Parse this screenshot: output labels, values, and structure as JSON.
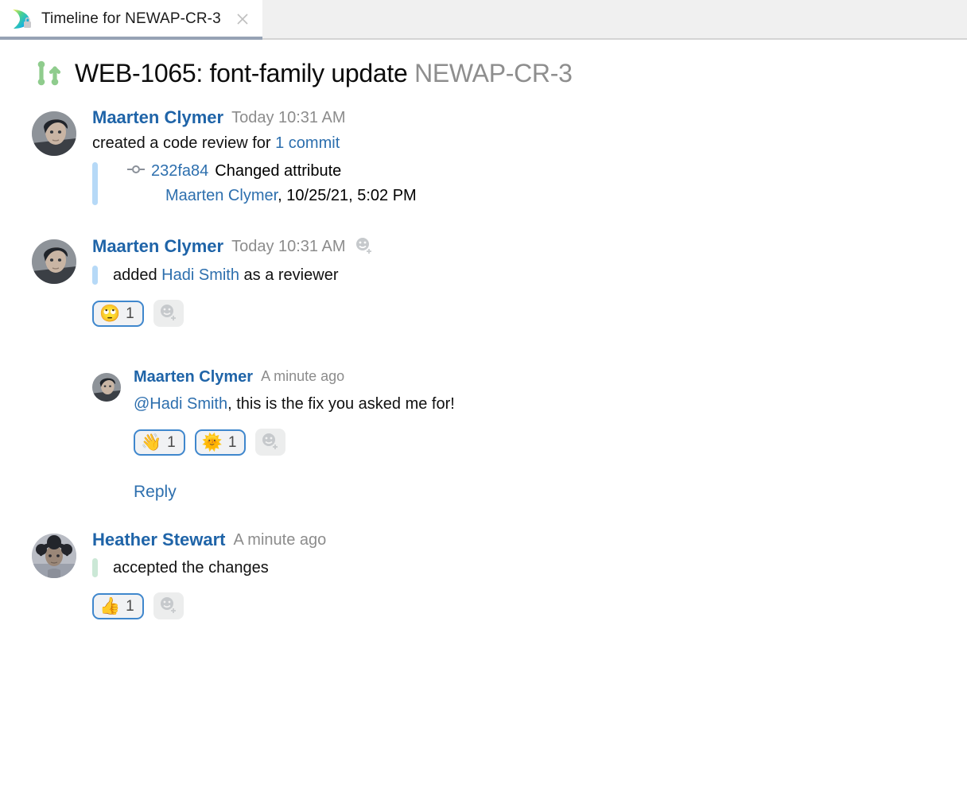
{
  "tab": {
    "title": "Timeline for NEWAP-CR-3",
    "icon": "upsource-logo-icon",
    "close_label": "×"
  },
  "header": {
    "icon": "branch-merge-icon",
    "issue_and_summary": "WEB-1065: font-family update",
    "review_key": "NEWAP-CR-3"
  },
  "colors": {
    "link": "#2d6fae",
    "author": "#1f64a8",
    "timestamp": "#8c8c8c",
    "rail_blue": "#b6d9f7",
    "rail_green": "#cbe8d6",
    "chip_border": "#3f87cd",
    "chip_background": "#f1f2f4",
    "tab_underline": "#96a2b4"
  },
  "timeline": [
    {
      "id": "entry-created-review",
      "author": "Maarten Clymer",
      "timestamp": "Today 10:31 AM",
      "text_prefix": "created a code review for ",
      "text_link": "1 commit",
      "commit": {
        "hash": "232fa84",
        "message": "Changed attribute",
        "author": "Maarten Clymer",
        "date": ", 10/25/21, 5:02 PM"
      }
    },
    {
      "id": "entry-added-reviewer",
      "author": "Maarten Clymer",
      "timestamp": "Today 10:31 AM",
      "text_prefix": "added ",
      "text_link": "Hadi Smith",
      "text_suffix": " as a reviewer",
      "reactions": [
        {
          "emoji": "🙄",
          "name": "face-with-rolling-eyes",
          "count": "1"
        }
      ],
      "add_reaction": "add-reaction"
    },
    {
      "id": "entry-reply-comment",
      "author": "Maarten Clymer",
      "timestamp": "A minute ago",
      "mention": "@Hadi Smith",
      "text_suffix": ", this is the fix you asked me for!",
      "reactions": [
        {
          "emoji": "👋",
          "name": "waving-hand",
          "count": "1"
        },
        {
          "emoji": "🌞",
          "name": "sun-with-face",
          "count": "1"
        }
      ],
      "reply_label": "Reply"
    },
    {
      "id": "entry-accepted",
      "author": "Heather Stewart",
      "timestamp": "A minute ago",
      "text": "accepted the changes",
      "reactions": [
        {
          "emoji": "👍",
          "name": "thumbs-up",
          "count": "1"
        }
      ]
    }
  ]
}
